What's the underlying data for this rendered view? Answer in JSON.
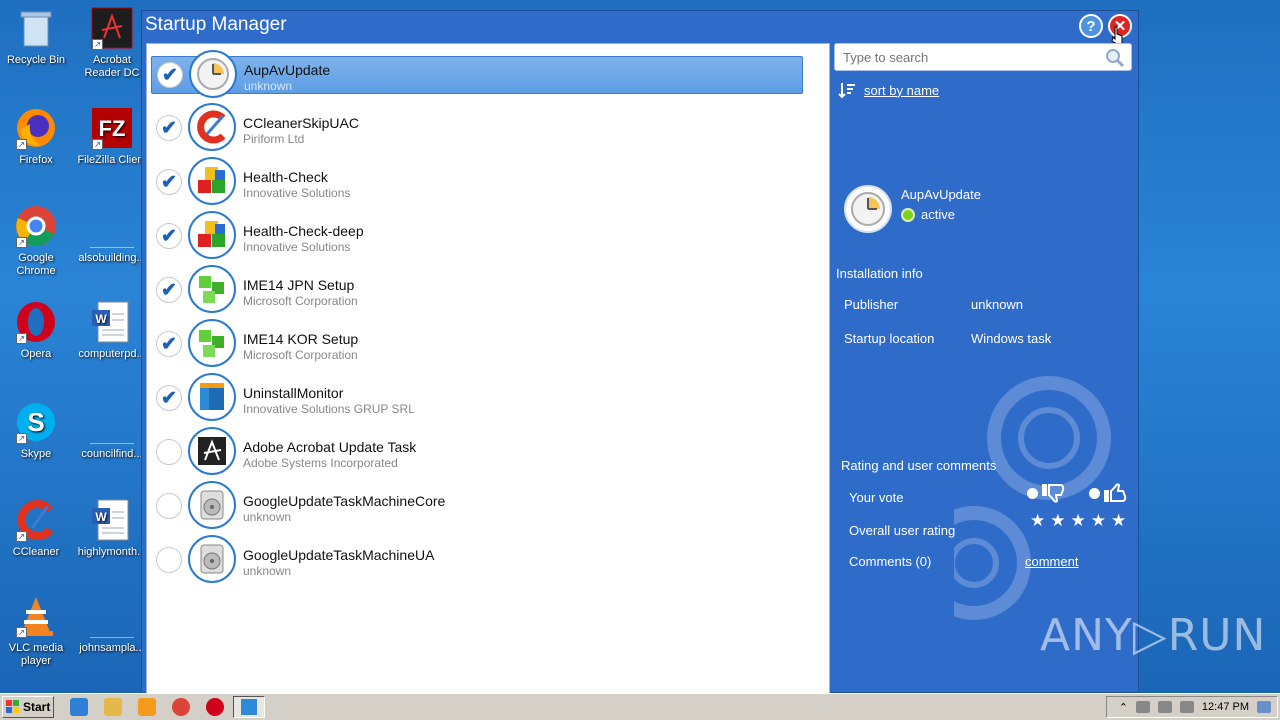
{
  "desktop": {
    "icons": [
      {
        "label": "Recycle Bin"
      },
      {
        "label": "Acrobat Reader DC"
      },
      {
        "label": "Firefox"
      },
      {
        "label": "FileZilla Client"
      },
      {
        "label": "Google Chrome"
      },
      {
        "label": "alsobuilding..."
      },
      {
        "label": "Opera"
      },
      {
        "label": "computerpd..."
      },
      {
        "label": "Skype"
      },
      {
        "label": "councilfind..."
      },
      {
        "label": "CCleaner"
      },
      {
        "label": "highlymonth..."
      },
      {
        "label": "VLC media player"
      },
      {
        "label": "johnsampla..."
      }
    ]
  },
  "window": {
    "title": "Startup Manager",
    "help_label": "?",
    "close_label": "✕"
  },
  "startup_list": [
    {
      "name": "AupAvUpdate",
      "publisher": "unknown",
      "enabled": true,
      "selected": true,
      "icon": "clock-icon"
    },
    {
      "name": "CCleanerSkipUAC",
      "publisher": "Piriform Ltd",
      "enabled": true,
      "selected": false,
      "icon": "ccleaner-icon"
    },
    {
      "name": "Health-Check",
      "publisher": "Innovative Solutions",
      "enabled": true,
      "selected": false,
      "icon": "cubes-icon"
    },
    {
      "name": "Health-Check-deep",
      "publisher": "Innovative Solutions",
      "enabled": true,
      "selected": false,
      "icon": "cubes-icon"
    },
    {
      "name": "IME14 JPN Setup",
      "publisher": "Microsoft Corporation",
      "enabled": true,
      "selected": false,
      "icon": "green-cubes-icon"
    },
    {
      "name": "IME14 KOR Setup",
      "publisher": "Microsoft Corporation",
      "enabled": true,
      "selected": false,
      "icon": "green-cubes-icon"
    },
    {
      "name": "UninstallMonitor",
      "publisher": "Innovative Solutions GRUP SRL",
      "enabled": true,
      "selected": false,
      "icon": "box-icon"
    },
    {
      "name": "Adobe Acrobat Update Task",
      "publisher": "Adobe Systems Incorporated",
      "enabled": false,
      "selected": false,
      "icon": "acrobat-icon"
    },
    {
      "name": "GoogleUpdateTaskMachineCore",
      "publisher": "unknown",
      "enabled": false,
      "selected": false,
      "icon": "installer-icon"
    },
    {
      "name": "GoogleUpdateTaskMachineUA",
      "publisher": "unknown",
      "enabled": false,
      "selected": false,
      "icon": "installer-icon"
    }
  ],
  "details": {
    "search_placeholder": "Type to search",
    "sort_label": "sort by name",
    "selected_name": "AupAvUpdate",
    "selected_status": "active",
    "installation_info_label": "Installation info",
    "publisher_label": "Publisher",
    "publisher_value": "unknown",
    "startup_location_label": "Startup location",
    "startup_location_value": "Windows task",
    "rating_section_label": "Rating and user comments",
    "your_vote_label": "Your vote",
    "overall_rating_label": "Overall user rating",
    "comments_label": "Comments (0)",
    "comment_link": "comment",
    "stars": 5
  },
  "watermark": "ANY▷RUN",
  "taskbar": {
    "start_label": "Start",
    "clock": "12:47 PM"
  }
}
